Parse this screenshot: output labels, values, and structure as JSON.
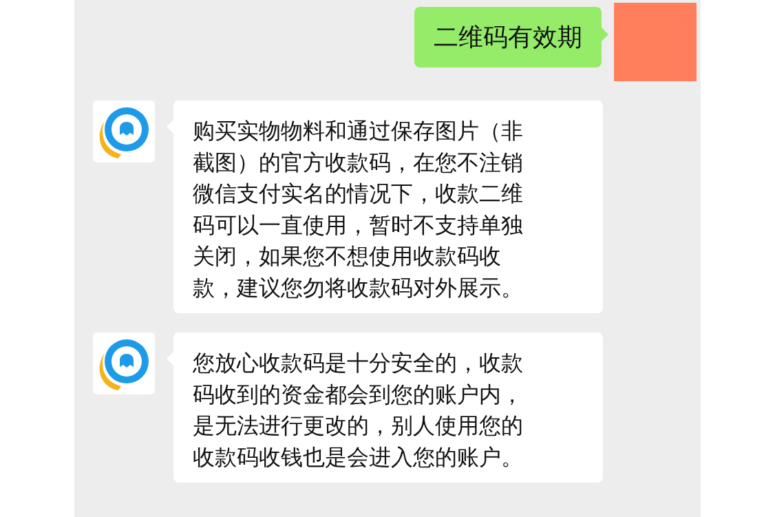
{
  "messages": [
    {
      "kind": "outgoing",
      "lines": [
        "二维码有效期"
      ]
    },
    {
      "kind": "incoming",
      "lines": [
        "购买实物物料和通过保存图片（非",
        "截图）的官方收款码，在您不注销",
        "微信支付实名的情况下，收款二维",
        "码可以一直使用，暂时不支持单独",
        "关闭，如果您不想使用收款码收",
        "款，建议您勿将收款码对外展示。"
      ]
    },
    {
      "kind": "incoming",
      "lines": [
        "您放心收款码是十分安全的，收款",
        "码收到的资金都会到您的账户内，",
        "是无法进行更改的，别人使用您的",
        "收款码收钱也是会进入您的账户。"
      ]
    }
  ]
}
